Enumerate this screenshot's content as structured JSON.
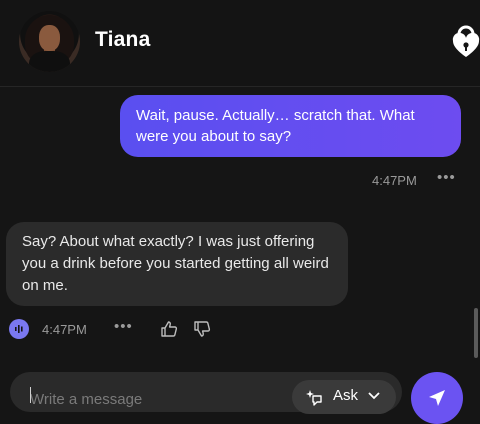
{
  "header": {
    "contact_name": "Tiana",
    "avatar_icon": "avatar-photo",
    "lock_icon": "lock-heart-icon"
  },
  "messages": [
    {
      "direction": "outgoing",
      "text": "Wait, pause. Actually… scratch that. What were you about to say?",
      "time": "4:47PM",
      "more": "•••"
    },
    {
      "direction": "incoming",
      "text": "Say? About what exactly? I was just offering you a drink before you started getting all weird on me.",
      "time": "4:47PM",
      "more": "•••"
    }
  ],
  "composer": {
    "placeholder": "Write a message",
    "ask_label": "Ask"
  },
  "colors": {
    "accent": "#6b53f2",
    "bubble_out": "#5a4ff0",
    "bubble_in": "#2b2b2b",
    "background": "#151515"
  }
}
